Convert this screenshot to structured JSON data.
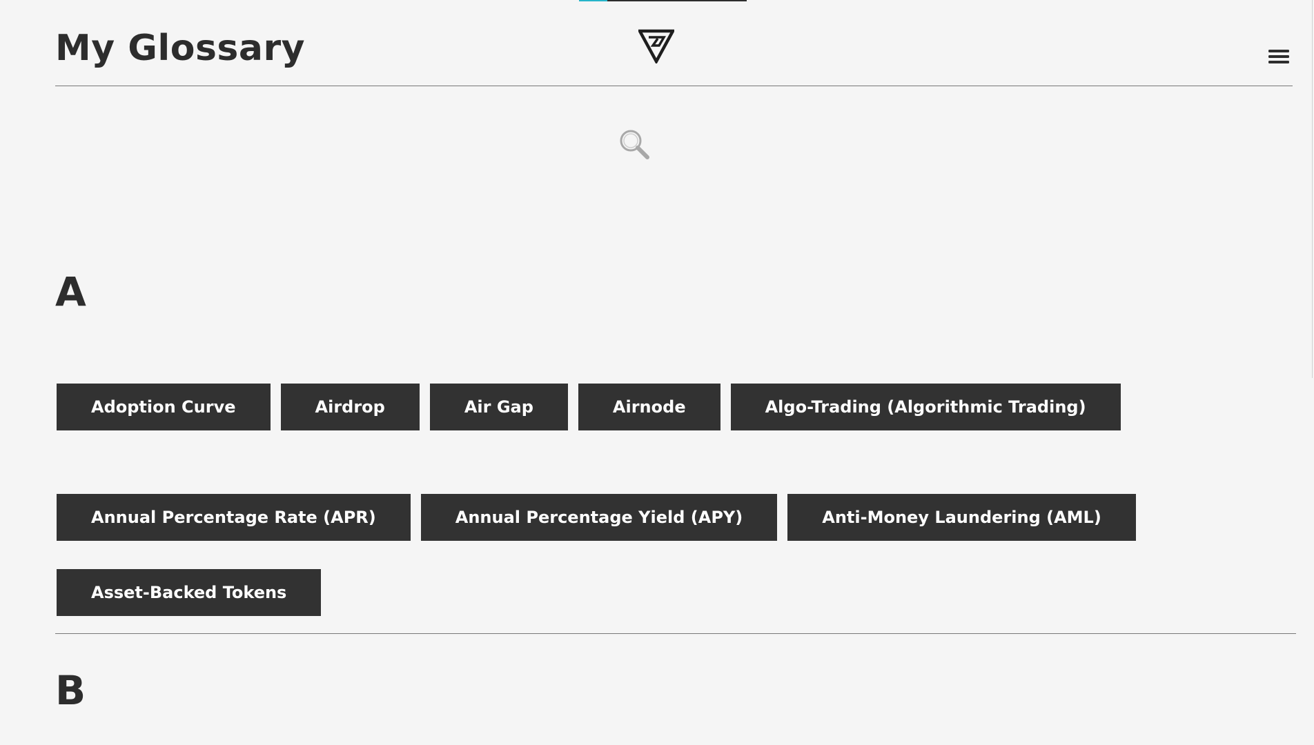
{
  "header": {
    "title": "My Glossary"
  },
  "scroll_progress": 0.17,
  "sections": {
    "a": {
      "letter": "A",
      "terms": [
        "Adoption Curve",
        "Airdrop",
        "Air Gap",
        "Airnode",
        "Algo-Trading (Algorithmic Trading)",
        "Annual Percentage Rate (APR)",
        "Annual Percentage Yield (APY)",
        "Anti-Money Laundering (AML)",
        "Asset-Backed Tokens"
      ]
    },
    "b": {
      "letter": "B"
    }
  },
  "icons": {
    "logo": "inverted-triangle-logo-icon",
    "menu": "hamburger-menu-icon",
    "search": "search-icon"
  },
  "colors": {
    "background": "#f5f5f5",
    "text": "#2d2d2d",
    "button_bg": "#323232",
    "button_text": "#ffffff",
    "accent": "#27b4c9"
  }
}
